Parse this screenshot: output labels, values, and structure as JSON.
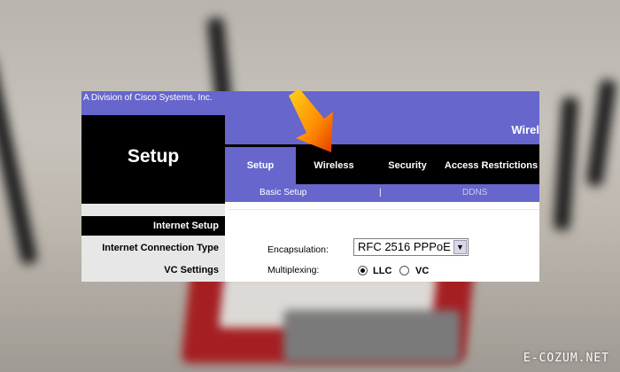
{
  "brand": {
    "division": "A Division of Cisco Systems, Inc.",
    "accent_color": "#6666cc"
  },
  "header": {
    "section_title": "Setup",
    "band_title": "Wirel"
  },
  "tabs": [
    {
      "label": "Setup",
      "active": true
    },
    {
      "label": "Wireless",
      "active": false
    },
    {
      "label": "Security",
      "active": false
    },
    {
      "label": "Access Restrictions",
      "active": false
    }
  ],
  "subnav": {
    "basic": "Basic Setup",
    "separator": "|",
    "ddns": "DDNS"
  },
  "sidebar": {
    "header": "Internet Setup",
    "items": [
      "Internet Connection Type",
      "VC Settings"
    ]
  },
  "form": {
    "encapsulation_label": "Encapsulation:",
    "encapsulation_value": "RFC 2516 PPPoE",
    "multiplexing_label": "Multiplexing:",
    "mux_options": [
      {
        "label": "LLC",
        "checked": true
      },
      {
        "label": "VC",
        "checked": false
      }
    ]
  },
  "watermark": "E-COZUM.NET",
  "icons": {
    "pointer_arrow": "orange-arrow-icon",
    "dropdown": "chevron-down-icon"
  }
}
